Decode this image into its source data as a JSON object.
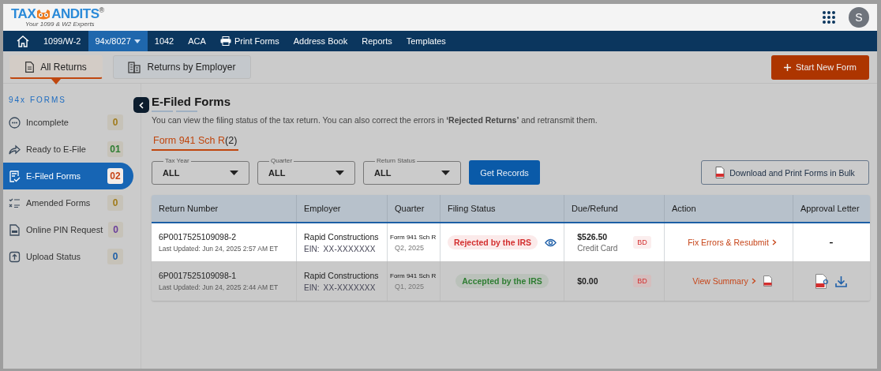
{
  "logo": {
    "part_1": "TAX",
    "part_2": "ANDITS",
    "mark": "®",
    "tagline": "Your 1099 & W2 Experts"
  },
  "user": {
    "initial": "S"
  },
  "nav": [
    {
      "kind": "home"
    },
    {
      "kind": "text",
      "label": "1099/W-2",
      "selected": false
    },
    {
      "kind": "menu",
      "label": "94x/8027",
      "selected": true
    },
    {
      "kind": "text",
      "label": "1042",
      "selected": false
    },
    {
      "kind": "text",
      "label": "ACA",
      "selected": false
    },
    {
      "kind": "printer",
      "label": "Print Forms",
      "selected": false
    },
    {
      "kind": "text",
      "label": "Address Book",
      "selected": false
    },
    {
      "kind": "text",
      "label": "Reports",
      "selected": false
    },
    {
      "kind": "text",
      "label": "Templates",
      "selected": false
    }
  ],
  "view_tabs": [
    {
      "label": "All Returns",
      "kind": "document",
      "selected": true
    },
    {
      "label": "Returns by Employer",
      "kind": "building",
      "selected": false
    }
  ],
  "start_button": "Start New Form",
  "sidebar": {
    "heading": "94x FORMS",
    "items": [
      {
        "label": "Incomplete",
        "kind": "dots",
        "count": "0",
        "color": "#a07b1a",
        "selected": false
      },
      {
        "label": "Ready to E-File",
        "kind": "share",
        "count": "01",
        "color": "#2e7d32",
        "selected": false
      },
      {
        "label": "E-Filed Forms",
        "kind": "check",
        "count": "02",
        "color": "#c7461a",
        "selected": true
      },
      {
        "label": "Amended Forms",
        "kind": "list",
        "count": "0",
        "color": "#a07b1a",
        "selected": false
      },
      {
        "label": "Online PIN Request",
        "kind": "pin",
        "count": "0",
        "color": "#6a3d9a",
        "selected": false
      },
      {
        "label": "Upload Status",
        "kind": "upload",
        "count": "0",
        "color": "#1e5fa8",
        "selected": false
      }
    ]
  },
  "page": {
    "title": "E-Filed Forms",
    "description": "You can view the filing status of the tax return. You can also correct the errors in **‘Rejected Returns’** and retransmit them."
  },
  "form_tabs": [
    {
      "label": "Form 941 Sch R",
      "count": "(2)",
      "selected": true
    }
  ],
  "filters": [
    {
      "label": "Tax Year",
      "value": "ALL"
    },
    {
      "label": "Quarter",
      "value": "ALL"
    },
    {
      "label": "Return Status",
      "value": "ALL"
    }
  ],
  "get_records": "Get Records",
  "bulk_button": "Download and Print Forms in Bulk",
  "table": {
    "columns": [
      "Return Number",
      "Employer",
      "Quarter",
      "Filing Status",
      "Due/Refund",
      "Action",
      "Approval Letter"
    ],
    "rows": [
      {
        "selected": true,
        "return_number": "6P0017525109098-2",
        "last_updated": "Last Updated: Jun 24, 2025 2:57 AM ET",
        "employer": "Rapid Constructions",
        "ein_label": "EIN:",
        "ein": "XX-XXXXXXX",
        "form": "Form 941 Sch R",
        "quarter": "Q2, 2025",
        "status": {
          "text": "Rejected by the IRS",
          "color": "#d32f2f"
        },
        "eye_icon": true,
        "action_pdf_icon": false,
        "approval_icons": false,
        "amount": "$526.50",
        "payment": "Credit Card",
        "badge": "BD",
        "action": "Fix Errors & Resubmit",
        "approval": "-"
      },
      {
        "selected": false,
        "return_number": "6P0017525109098-1",
        "last_updated": "Last Updated: Jun 24, 2025 2:44 AM ET",
        "employer": "Rapid Constructions",
        "ein_label": "EIN:",
        "ein": "XX-XXXXXXX",
        "form": "Form 941 Sch R",
        "quarter": "Q1, 2025",
        "status": {
          "text": "Accepted by the IRS",
          "color": "#2e7d32"
        },
        "amount": "$0.00",
        "badge": "BD",
        "action": "View Summary",
        "eye_icon": false,
        "action_pdf_icon": true,
        "approval_icons": true
      }
    ]
  }
}
